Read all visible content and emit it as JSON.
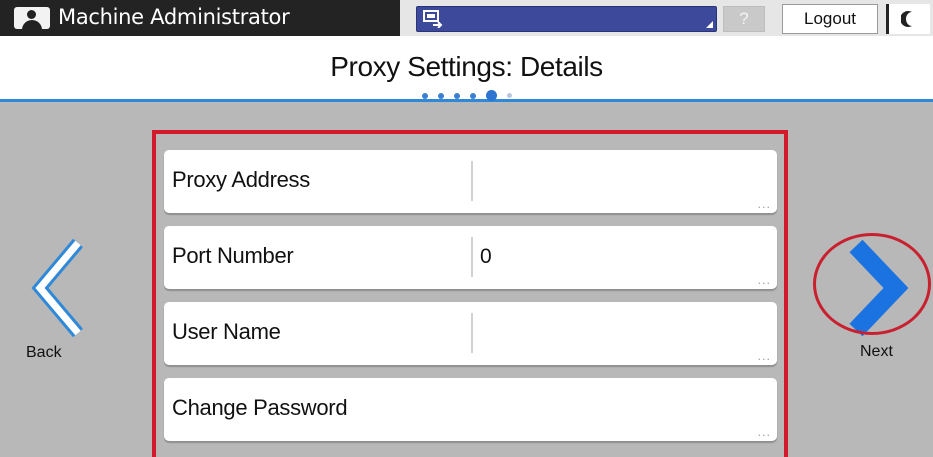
{
  "header": {
    "user_name": "Machine Administrator",
    "user_icon": "user-icon",
    "status_icon": "network-device-icon",
    "help_label": "?",
    "logout_label": "Logout",
    "energy_icon": "moon-icon",
    "colors": {
      "topbar": "#232323",
      "status_field": "#3d4a9c",
      "title_rule": "#2f89d8"
    }
  },
  "title": {
    "text": "Proxy Settings: Details",
    "pagination": {
      "total_pages": 6,
      "current_page": 5
    }
  },
  "navigation": {
    "back_label": "Back",
    "back_icon": "chevron-left-icon",
    "next_label": "Next",
    "next_icon": "chevron-right-icon"
  },
  "settings": [
    {
      "label": "Proxy Address",
      "value": "",
      "has_value_field": true
    },
    {
      "label": "Port Number",
      "value": "0",
      "has_value_field": true
    },
    {
      "label": "User Name",
      "value": "",
      "has_value_field": true
    },
    {
      "label": "Change Password",
      "value": "",
      "has_value_field": false
    }
  ],
  "row_ellipsis": "...",
  "annotations": {
    "highlight_color": "#d31a2b"
  }
}
